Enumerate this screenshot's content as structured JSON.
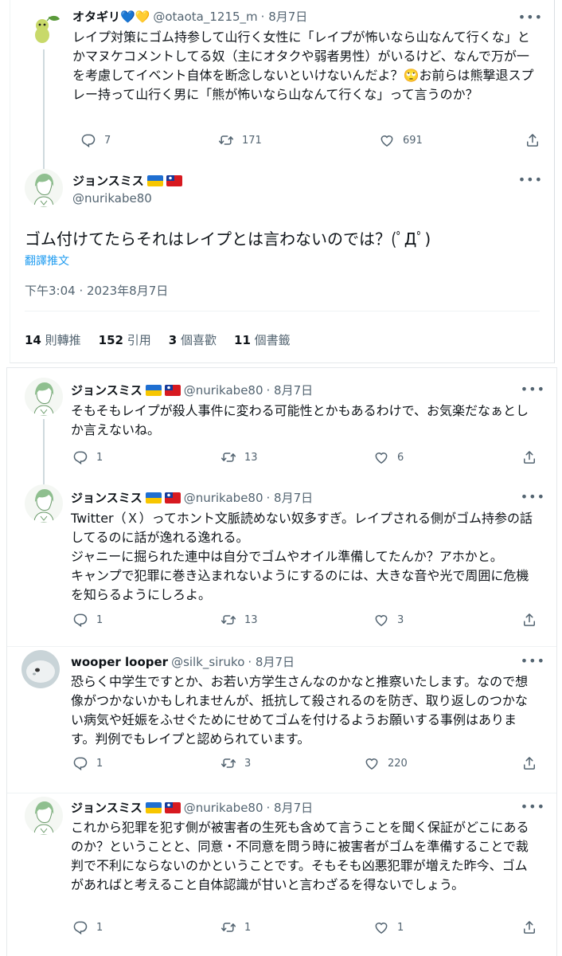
{
  "tweet_top": {
    "name": "オタギリ💙💛",
    "handle": "@otaota_1215_m",
    "date": "· 8月7日",
    "text": "レイプ対策にゴム持参して山行く女性に「レイプが怖いなら山なんて行くな」とかマヌケコメントしてる奴（主にオタクや弱者男性）がいるけど、なんで万が一を考慮してイベント自体を断念しないといけないんだよ？🙄お前らは熊撃退スプレー持って山行く男に「熊が怖いなら山なんて行くな」って言うのか？",
    "replies": "7",
    "retweets": "171",
    "likes": "691"
  },
  "main_tweet": {
    "name": "ジョンスミス",
    "handle": "@nurikabe80",
    "text": "ゴム付けてたらそれはレイプとは言わないのでは？(ﾟДﾟ)",
    "translate": "翻譯推文",
    "timestamp": "下午3:04 · 2023年8月7日",
    "stats": [
      {
        "count": "14",
        "label": "則轉推"
      },
      {
        "count": "152",
        "label": "引用"
      },
      {
        "count": "3",
        "label": "個喜歡"
      },
      {
        "count": "11",
        "label": "個書籤"
      }
    ]
  },
  "replies": [
    {
      "name": "ジョンスミス",
      "handle": "@nurikabe80",
      "date": "· 8月7日",
      "text": "そもそもレイプが殺人事件に変わる可能性とかもあるわけで、お気楽だなぁとしか言えないね。",
      "replies": "1",
      "retweets": "13",
      "likes": "6"
    },
    {
      "name": "ジョンスミス",
      "handle": "@nurikabe80",
      "date": "· 8月7日",
      "text": "Twitter（Ｘ）ってホント文脈読めない奴多すぎ。レイプされる側がゴム持参の話してるのに話が逸れる逸れる。\nジャニーに掘られた連中は自分でゴムやオイル準備してたんか？アホかと。\nキャンプで犯罪に巻き込まれないようにするのには、大きな音や光で周囲に危機を知らるようにしろよ。",
      "replies": "1",
      "retweets": "13",
      "likes": "3"
    },
    {
      "name": "wooper looper",
      "handle": "@silk_siruko",
      "date": "· 8月7日",
      "text": "恐らく中学生ですとか、お若い方学生さんなのかなと推察いたします。なので想像がつかないかもしれませんが、抵抗して殺されるのを防ぎ、取り返しのつかない病気や妊娠をふせぐためにせめてゴムを付けるようお願いする事例はあります。判例でもレイプと認められています。",
      "replies": "1",
      "retweets": "3",
      "likes": "220"
    },
    {
      "name": "ジョンスミス",
      "handle": "@nurikabe80",
      "date": "· 8月7日",
      "text": "これから犯罪を犯す側が被害者の生死も含めて言うことを聞く保証がどこにあるのか？ということと、同意・不同意を問う時に被害者がゴムを準備することで裁判で不利にならないのかということです。そもそも凶悪犯罪が増えた昨今、ゴムがあればと考えること自体認識が甘いと言わざるを得ないでしょう。",
      "replies": "1",
      "retweets": "1",
      "likes": "1"
    }
  ],
  "colors": {
    "text": "#0f1419",
    "secondary": "#536471",
    "link": "#1d9bf0",
    "thread_line": "#cfd9de"
  },
  "icons": {
    "reply": "reply-icon",
    "retweet": "retweet-icon",
    "like": "heart-icon",
    "share": "share-icon",
    "more": "more-icon"
  }
}
